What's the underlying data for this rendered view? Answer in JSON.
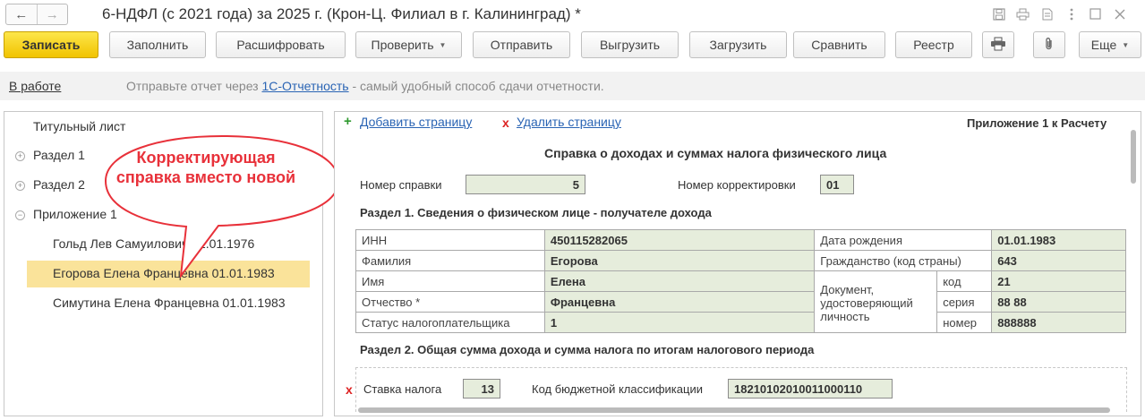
{
  "window": {
    "title": "6-НДФЛ (с 2021 года) за 2025 г. (Крон-Ц. Филиал в г. Калининград) *",
    "back_glyph": "←",
    "forward_glyph": "→",
    "icons": [
      "save-icon",
      "print-icon",
      "document-icon",
      "more-vertical-icon",
      "maximize-icon",
      "close-icon"
    ]
  },
  "toolbar": {
    "save": "Записать",
    "fill": "Заполнить",
    "decode": "Расшифровать",
    "check": "Проверить",
    "send": "Отправить",
    "unload": "Выгрузить",
    "load": "Загрузить",
    "compare": "Сравнить",
    "registry": "Реестр",
    "more": "Еще"
  },
  "infobar": {
    "status": "В работе",
    "text_before": "Отправьте отчет через ",
    "link": "1С-Отчетность",
    "text_after": " - самый удобный способ сдачи отчетности."
  },
  "tree": {
    "items": [
      {
        "label": "Титульный лист"
      },
      {
        "label": "Раздел 1"
      },
      {
        "label": "Раздел 2"
      },
      {
        "label": "Приложение 1"
      },
      {
        "label": "Гольд Лев Самуилович 01.01.1976"
      },
      {
        "label": "Егорова Елена Францевна 01.01.1983"
      },
      {
        "label": "Симутина Елена Францевна 01.01.1983"
      }
    ]
  },
  "callout": {
    "text": "Корректирующая справка вместо новой",
    "color": "#e8313a"
  },
  "form": {
    "add_page": "Добавить страницу",
    "delete_page": "Удалить страницу",
    "annex_label": "Приложение 1 к Расчету",
    "title": "Справка о доходах и суммах налога физического лица",
    "cert_number_label": "Номер справки",
    "cert_number": "5",
    "correction_label": "Номер корректировки",
    "correction": "01",
    "section1_title": "Раздел 1. Сведения о физическом лице - получателе дохода",
    "inn_label": "ИНН",
    "inn": "450115282065",
    "birthdate_label": "Дата рождения",
    "birthdate": "01.01.1983",
    "surname_label": "Фамилия",
    "surname": "Егорова",
    "citizenship_label": "Гражданство (код страны)",
    "citizenship": "643",
    "name_label": "Имя",
    "name": "Елена",
    "doc_label": "Документ, удостоверяющий личность",
    "doc_code_label": "код",
    "doc_code": "21",
    "patronymic_label": "Отчество *",
    "patronymic": "Францевна",
    "doc_series_label": "серия",
    "doc_series": "88 88",
    "taxpayer_status_label": "Статус налогоплательщика",
    "taxpayer_status": "1",
    "doc_number_label": "номер",
    "doc_number": "888888",
    "section2_title": "Раздел 2. Общая сумма дохода и сумма налога по итогам налогового периода",
    "tax_rate_label": "Ставка налога",
    "tax_rate": "13",
    "kbk_label": "Код бюджетной классификации",
    "kbk": "18210102010011000110"
  },
  "colors": {
    "accent_yellow": "#f1c300",
    "field_green": "#e6eddc",
    "link_blue": "#2a64b4",
    "selection": "#fae39a"
  }
}
